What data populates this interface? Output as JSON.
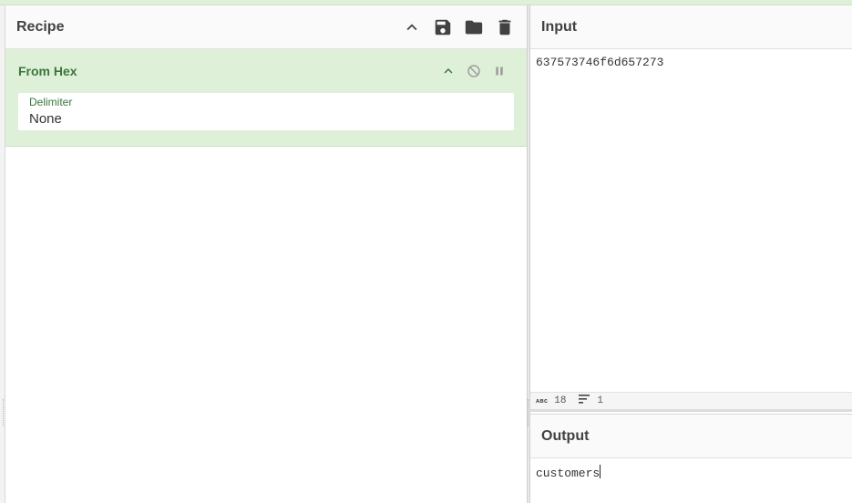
{
  "recipe": {
    "title": "Recipe",
    "icons": [
      "chevron-up-icon",
      "save-icon",
      "folder-icon",
      "trash-icon"
    ],
    "operation": {
      "name": "From Hex",
      "args": [
        {
          "label": "Delimiter",
          "value": "None"
        }
      ]
    }
  },
  "input": {
    "title": "Input",
    "value": "637573746f6d657273",
    "status": {
      "length_icon": "abc",
      "length": "18",
      "lines": "1"
    }
  },
  "output": {
    "title": "Output",
    "value": "customers"
  },
  "colors": {
    "accent_green_bg": "#dff0d8",
    "accent_green_text": "#3c763d"
  }
}
